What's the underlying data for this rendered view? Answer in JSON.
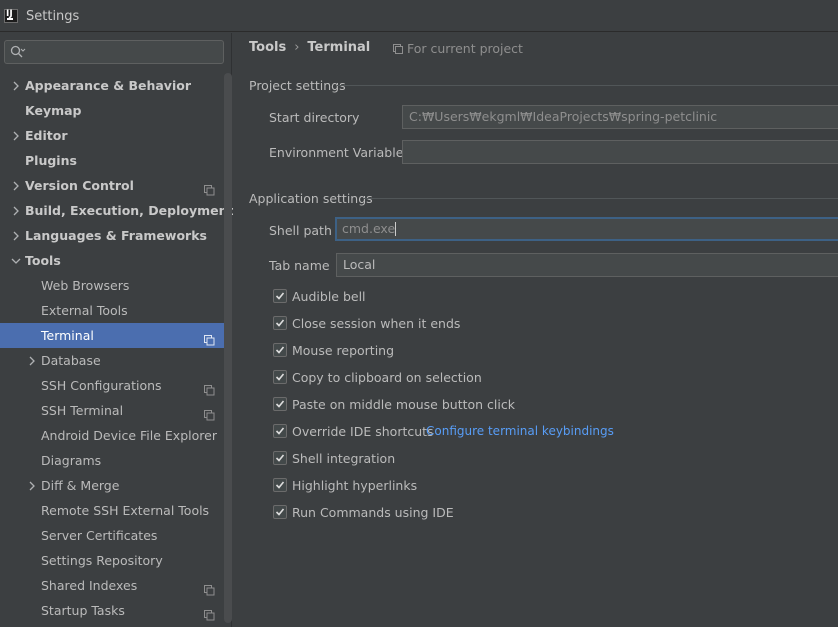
{
  "window": {
    "title": "Settings",
    "app_icon_letters": "IJ"
  },
  "search": {
    "placeholder": "",
    "icon": "search-icon"
  },
  "tree": {
    "items": [
      {
        "label": "Appearance & Behavior",
        "level": 0,
        "expandable": true,
        "expanded": false,
        "bold": true,
        "project_icon": false,
        "selected": false
      },
      {
        "label": "Keymap",
        "level": 0,
        "expandable": false,
        "expanded": false,
        "bold": true,
        "project_icon": false,
        "selected": false
      },
      {
        "label": "Editor",
        "level": 0,
        "expandable": true,
        "expanded": false,
        "bold": true,
        "project_icon": false,
        "selected": false
      },
      {
        "label": "Plugins",
        "level": 0,
        "expandable": false,
        "expanded": false,
        "bold": true,
        "project_icon": false,
        "selected": false
      },
      {
        "label": "Version Control",
        "level": 0,
        "expandable": true,
        "expanded": false,
        "bold": true,
        "project_icon": true,
        "selected": false
      },
      {
        "label": "Build, Execution, Deployment",
        "level": 0,
        "expandable": true,
        "expanded": false,
        "bold": true,
        "project_icon": false,
        "selected": false
      },
      {
        "label": "Languages & Frameworks",
        "level": 0,
        "expandable": true,
        "expanded": false,
        "bold": true,
        "project_icon": false,
        "selected": false
      },
      {
        "label": "Tools",
        "level": 0,
        "expandable": true,
        "expanded": true,
        "bold": true,
        "project_icon": false,
        "selected": false
      },
      {
        "label": "Web Browsers",
        "level": 1,
        "expandable": false,
        "expanded": false,
        "bold": false,
        "project_icon": false,
        "selected": false
      },
      {
        "label": "External Tools",
        "level": 1,
        "expandable": false,
        "expanded": false,
        "bold": false,
        "project_icon": false,
        "selected": false
      },
      {
        "label": "Terminal",
        "level": 1,
        "expandable": false,
        "expanded": false,
        "bold": false,
        "project_icon": true,
        "selected": true
      },
      {
        "label": "Database",
        "level": 1,
        "expandable": true,
        "expanded": false,
        "bold": false,
        "project_icon": false,
        "selected": false
      },
      {
        "label": "SSH Configurations",
        "level": 1,
        "expandable": false,
        "expanded": false,
        "bold": false,
        "project_icon": true,
        "selected": false
      },
      {
        "label": "SSH Terminal",
        "level": 1,
        "expandable": false,
        "expanded": false,
        "bold": false,
        "project_icon": true,
        "selected": false
      },
      {
        "label": "Android Device File Explorer",
        "level": 1,
        "expandable": false,
        "expanded": false,
        "bold": false,
        "project_icon": false,
        "selected": false
      },
      {
        "label": "Diagrams",
        "level": 1,
        "expandable": false,
        "expanded": false,
        "bold": false,
        "project_icon": false,
        "selected": false
      },
      {
        "label": "Diff & Merge",
        "level": 1,
        "expandable": true,
        "expanded": false,
        "bold": false,
        "project_icon": false,
        "selected": false
      },
      {
        "label": "Remote SSH External Tools",
        "level": 1,
        "expandable": false,
        "expanded": false,
        "bold": false,
        "project_icon": false,
        "selected": false
      },
      {
        "label": "Server Certificates",
        "level": 1,
        "expandable": false,
        "expanded": false,
        "bold": false,
        "project_icon": false,
        "selected": false
      },
      {
        "label": "Settings Repository",
        "level": 1,
        "expandable": false,
        "expanded": false,
        "bold": false,
        "project_icon": false,
        "selected": false
      },
      {
        "label": "Shared Indexes",
        "level": 1,
        "expandable": false,
        "expanded": false,
        "bold": false,
        "project_icon": true,
        "selected": false
      },
      {
        "label": "Startup Tasks",
        "level": 1,
        "expandable": false,
        "expanded": false,
        "bold": false,
        "project_icon": true,
        "selected": false
      }
    ]
  },
  "breadcrumb": {
    "parent": "Tools",
    "separator": "›",
    "current": "Terminal",
    "scope": "For current project"
  },
  "project_settings": {
    "title": "Project settings",
    "start_directory": {
      "label": "Start directory",
      "value": "C:₩Users₩ekgml₩IdeaProjects₩spring-petclinic"
    },
    "env_vars": {
      "label": "Environment Variables",
      "value": ""
    }
  },
  "app_settings": {
    "title": "Application settings",
    "shell_path": {
      "label": "Shell path",
      "value": "cmd.exe"
    },
    "tab_name": {
      "label": "Tab name",
      "value": "Local"
    }
  },
  "checkboxes": [
    {
      "label": "Audible bell",
      "checked": true
    },
    {
      "label": "Close session when it ends",
      "checked": true
    },
    {
      "label": "Mouse reporting",
      "checked": true
    },
    {
      "label": "Copy to clipboard on selection",
      "checked": true
    },
    {
      "label": "Paste on middle mouse button click",
      "checked": true
    },
    {
      "label": "Override IDE shortcuts",
      "checked": true
    },
    {
      "label": "Shell integration",
      "checked": true
    },
    {
      "label": "Highlight hyperlinks",
      "checked": true
    },
    {
      "label": "Run Commands using IDE",
      "checked": true
    }
  ],
  "keybindings_link": "Configure terminal keybindings",
  "colors": {
    "accent": "#4b6eaf",
    "link": "#589df6",
    "background": "#3c3f41",
    "focus_border": "#3d6185"
  }
}
